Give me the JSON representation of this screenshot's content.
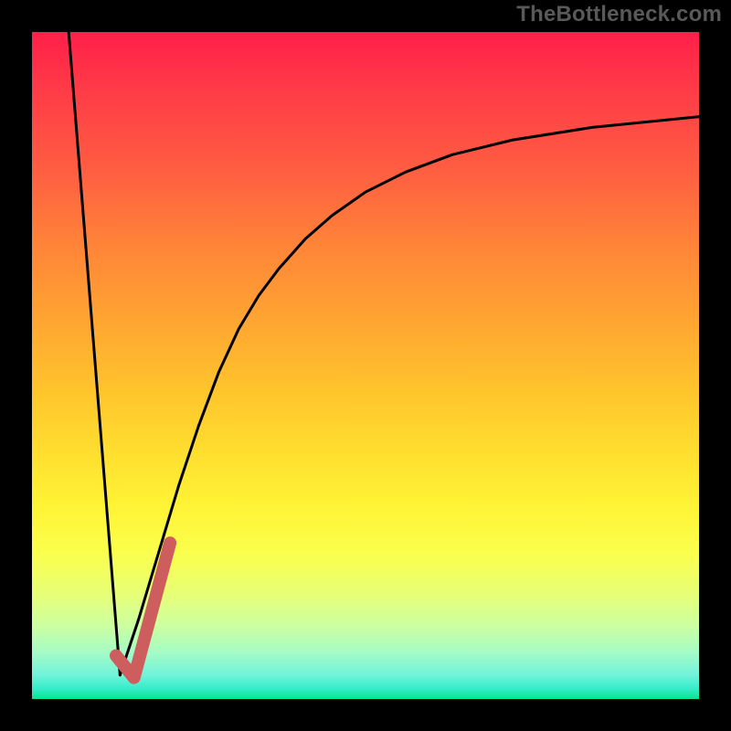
{
  "watermark": "TheBottleneck.com",
  "chart_data": {
    "type": "line",
    "title": "",
    "xlabel": "",
    "ylabel": "",
    "xlim": [
      0,
      100
    ],
    "ylim": [
      0,
      100
    ],
    "series": [
      {
        "name": "left-descent",
        "stroke": "#000000",
        "stroke_width": 3,
        "x": [
          5.5,
          13.2
        ],
        "y": [
          100,
          3.6
        ]
      },
      {
        "name": "right-curve",
        "stroke": "#000000",
        "stroke_width": 3,
        "x": [
          13.2,
          16,
          19,
          22,
          25,
          28,
          31,
          34,
          37,
          41,
          45,
          50,
          56,
          63,
          72,
          84,
          100
        ],
        "y": [
          3.6,
          12,
          22,
          32,
          41,
          49,
          55.5,
          60.5,
          64.5,
          69,
          72.5,
          76,
          79,
          81.6,
          83.8,
          85.7,
          87.3
        ]
      },
      {
        "name": "check-mark",
        "stroke": "#cd5e5d",
        "stroke_width": 14,
        "x": [
          12.6,
          15.3,
          20.7
        ],
        "y": [
          6.5,
          3.2,
          23.4
        ]
      }
    ],
    "gradient_stops": [
      {
        "pos": 0,
        "color": "#ff1f49"
      },
      {
        "pos": 9,
        "color": "#ff3c47"
      },
      {
        "pos": 20,
        "color": "#ff5b42"
      },
      {
        "pos": 32,
        "color": "#ff8438"
      },
      {
        "pos": 44,
        "color": "#ffa731"
      },
      {
        "pos": 54,
        "color": "#ffc52c"
      },
      {
        "pos": 63,
        "color": "#ffde2f"
      },
      {
        "pos": 71,
        "color": "#fff335"
      },
      {
        "pos": 78,
        "color": "#faff4c"
      },
      {
        "pos": 84,
        "color": "#e8ff74"
      },
      {
        "pos": 89,
        "color": "#ccffa0"
      },
      {
        "pos": 93,
        "color": "#a5fcc6"
      },
      {
        "pos": 96.5,
        "color": "#6ff3db"
      },
      {
        "pos": 98.5,
        "color": "#34ecc8"
      },
      {
        "pos": 100,
        "color": "#07e58e"
      }
    ]
  }
}
